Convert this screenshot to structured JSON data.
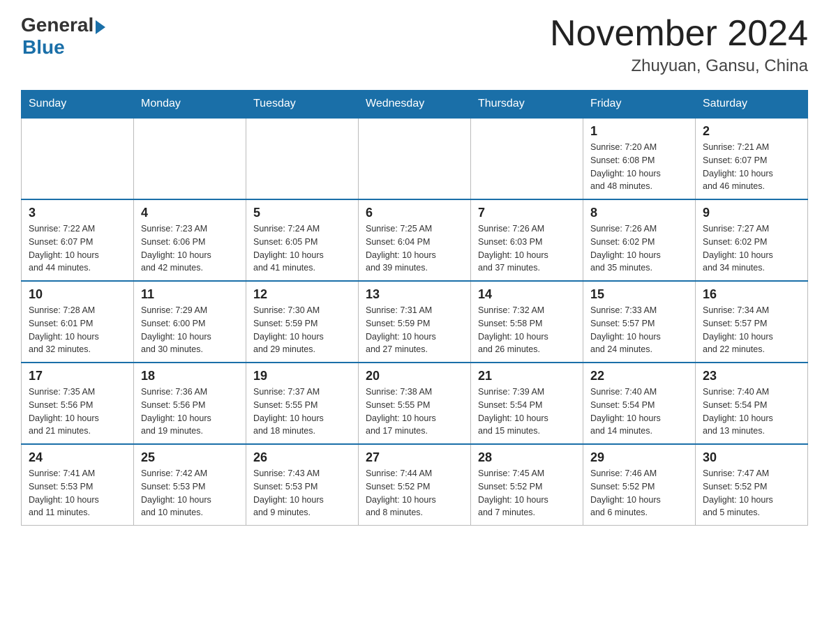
{
  "header": {
    "logo_general": "General",
    "logo_blue": "Blue",
    "month_title": "November 2024",
    "location": "Zhuyuan, Gansu, China"
  },
  "weekdays": [
    "Sunday",
    "Monday",
    "Tuesday",
    "Wednesday",
    "Thursday",
    "Friday",
    "Saturday"
  ],
  "weeks": [
    [
      {
        "day": "",
        "info": ""
      },
      {
        "day": "",
        "info": ""
      },
      {
        "day": "",
        "info": ""
      },
      {
        "day": "",
        "info": ""
      },
      {
        "day": "",
        "info": ""
      },
      {
        "day": "1",
        "info": "Sunrise: 7:20 AM\nSunset: 6:08 PM\nDaylight: 10 hours\nand 48 minutes."
      },
      {
        "day": "2",
        "info": "Sunrise: 7:21 AM\nSunset: 6:07 PM\nDaylight: 10 hours\nand 46 minutes."
      }
    ],
    [
      {
        "day": "3",
        "info": "Sunrise: 7:22 AM\nSunset: 6:07 PM\nDaylight: 10 hours\nand 44 minutes."
      },
      {
        "day": "4",
        "info": "Sunrise: 7:23 AM\nSunset: 6:06 PM\nDaylight: 10 hours\nand 42 minutes."
      },
      {
        "day": "5",
        "info": "Sunrise: 7:24 AM\nSunset: 6:05 PM\nDaylight: 10 hours\nand 41 minutes."
      },
      {
        "day": "6",
        "info": "Sunrise: 7:25 AM\nSunset: 6:04 PM\nDaylight: 10 hours\nand 39 minutes."
      },
      {
        "day": "7",
        "info": "Sunrise: 7:26 AM\nSunset: 6:03 PM\nDaylight: 10 hours\nand 37 minutes."
      },
      {
        "day": "8",
        "info": "Sunrise: 7:26 AM\nSunset: 6:02 PM\nDaylight: 10 hours\nand 35 minutes."
      },
      {
        "day": "9",
        "info": "Sunrise: 7:27 AM\nSunset: 6:02 PM\nDaylight: 10 hours\nand 34 minutes."
      }
    ],
    [
      {
        "day": "10",
        "info": "Sunrise: 7:28 AM\nSunset: 6:01 PM\nDaylight: 10 hours\nand 32 minutes."
      },
      {
        "day": "11",
        "info": "Sunrise: 7:29 AM\nSunset: 6:00 PM\nDaylight: 10 hours\nand 30 minutes."
      },
      {
        "day": "12",
        "info": "Sunrise: 7:30 AM\nSunset: 5:59 PM\nDaylight: 10 hours\nand 29 minutes."
      },
      {
        "day": "13",
        "info": "Sunrise: 7:31 AM\nSunset: 5:59 PM\nDaylight: 10 hours\nand 27 minutes."
      },
      {
        "day": "14",
        "info": "Sunrise: 7:32 AM\nSunset: 5:58 PM\nDaylight: 10 hours\nand 26 minutes."
      },
      {
        "day": "15",
        "info": "Sunrise: 7:33 AM\nSunset: 5:57 PM\nDaylight: 10 hours\nand 24 minutes."
      },
      {
        "day": "16",
        "info": "Sunrise: 7:34 AM\nSunset: 5:57 PM\nDaylight: 10 hours\nand 22 minutes."
      }
    ],
    [
      {
        "day": "17",
        "info": "Sunrise: 7:35 AM\nSunset: 5:56 PM\nDaylight: 10 hours\nand 21 minutes."
      },
      {
        "day": "18",
        "info": "Sunrise: 7:36 AM\nSunset: 5:56 PM\nDaylight: 10 hours\nand 19 minutes."
      },
      {
        "day": "19",
        "info": "Sunrise: 7:37 AM\nSunset: 5:55 PM\nDaylight: 10 hours\nand 18 minutes."
      },
      {
        "day": "20",
        "info": "Sunrise: 7:38 AM\nSunset: 5:55 PM\nDaylight: 10 hours\nand 17 minutes."
      },
      {
        "day": "21",
        "info": "Sunrise: 7:39 AM\nSunset: 5:54 PM\nDaylight: 10 hours\nand 15 minutes."
      },
      {
        "day": "22",
        "info": "Sunrise: 7:40 AM\nSunset: 5:54 PM\nDaylight: 10 hours\nand 14 minutes."
      },
      {
        "day": "23",
        "info": "Sunrise: 7:40 AM\nSunset: 5:54 PM\nDaylight: 10 hours\nand 13 minutes."
      }
    ],
    [
      {
        "day": "24",
        "info": "Sunrise: 7:41 AM\nSunset: 5:53 PM\nDaylight: 10 hours\nand 11 minutes."
      },
      {
        "day": "25",
        "info": "Sunrise: 7:42 AM\nSunset: 5:53 PM\nDaylight: 10 hours\nand 10 minutes."
      },
      {
        "day": "26",
        "info": "Sunrise: 7:43 AM\nSunset: 5:53 PM\nDaylight: 10 hours\nand 9 minutes."
      },
      {
        "day": "27",
        "info": "Sunrise: 7:44 AM\nSunset: 5:52 PM\nDaylight: 10 hours\nand 8 minutes."
      },
      {
        "day": "28",
        "info": "Sunrise: 7:45 AM\nSunset: 5:52 PM\nDaylight: 10 hours\nand 7 minutes."
      },
      {
        "day": "29",
        "info": "Sunrise: 7:46 AM\nSunset: 5:52 PM\nDaylight: 10 hours\nand 6 minutes."
      },
      {
        "day": "30",
        "info": "Sunrise: 7:47 AM\nSunset: 5:52 PM\nDaylight: 10 hours\nand 5 minutes."
      }
    ]
  ]
}
